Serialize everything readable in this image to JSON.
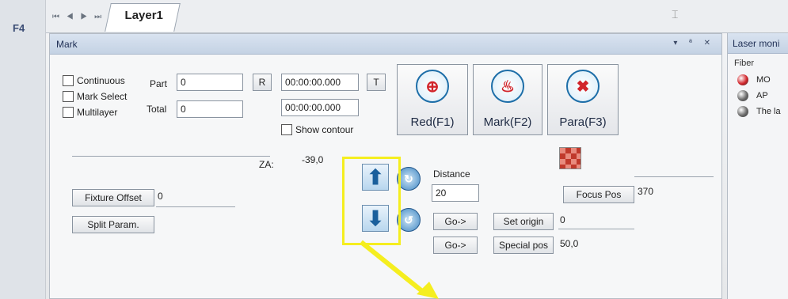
{
  "sidebar": {
    "f_key": "F4"
  },
  "tabs": {
    "nav_glyphs": "⏮ ◀ ▶ ⏭",
    "active_tab": "Layer1"
  },
  "panel": {
    "title": "Mark",
    "controls": "▾ ª ✕",
    "continuous_label": "Continuous",
    "mark_select_label": "Mark Select",
    "multilayer_label": "Multilayer",
    "part_label": "Part",
    "part_value": "0",
    "total_label": "Total",
    "total_value": "0",
    "r_button": "R",
    "t_button": "T",
    "time1": "00:00:00.000",
    "time2": "00:00:00.000",
    "show_contour_label": "Show contour",
    "red_button": "Red(F1)",
    "mark_button": "Mark(F2)",
    "para_button": "Para(F3)",
    "za_label": "ZA:",
    "za_value": "-39,0",
    "fixture_offset_button": "Fixture Offset",
    "fixture_offset_value": "0",
    "split_param_button": "Split Param.",
    "distance_label": "Distance",
    "distance_value": "20",
    "go_button_1": "Go->",
    "go_button_2": "Go->",
    "focus_pos_button": "Focus Pos",
    "focus_pos_value": "370",
    "set_origin_button": "Set origin",
    "set_origin_value": "0",
    "special_pos_button": "Special pos",
    "special_pos_value": "50,0"
  },
  "right_panel": {
    "title": "Laser moni",
    "group_label": "Fiber",
    "indicators": [
      {
        "label": "MO",
        "color": "#d1242a"
      },
      {
        "label": "AP",
        "color": "#6b6b6b"
      },
      {
        "label": "The la",
        "color": "#6b6b6b"
      }
    ]
  },
  "colors": {
    "highlight": "#f5ee1f",
    "accent": "#1d6ea8"
  }
}
